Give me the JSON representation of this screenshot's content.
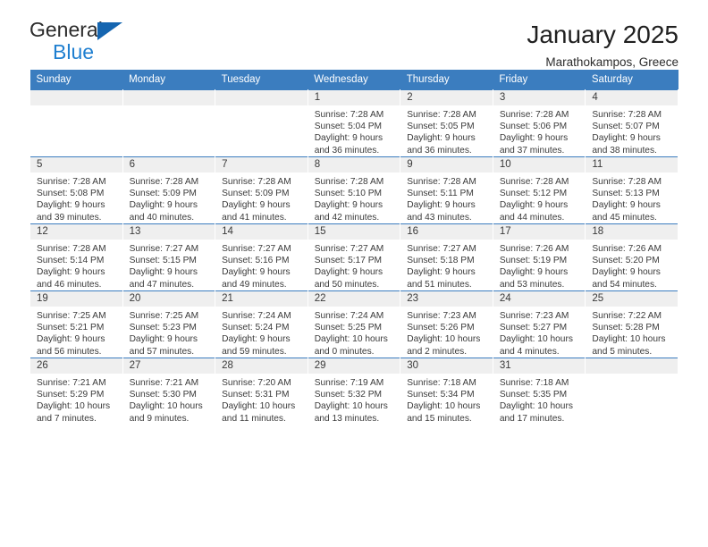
{
  "brand": {
    "line1": "General",
    "line2": "Blue",
    "triangle_color": "#1565b0",
    "blue_text_color": "#1f7fd0"
  },
  "header": {
    "title": "January 2025",
    "subtitle": "Marathokampos, Greece",
    "accent_color": "#3b7dbf",
    "daynum_band_color": "#efefef"
  },
  "weekday_headers": [
    "Sunday",
    "Monday",
    "Tuesday",
    "Wednesday",
    "Thursday",
    "Friday",
    "Saturday"
  ],
  "weeks": [
    [
      {
        "day": "",
        "sunrise": "",
        "sunset": "",
        "daylight_line1": "",
        "daylight_line2": ""
      },
      {
        "day": "",
        "sunrise": "",
        "sunset": "",
        "daylight_line1": "",
        "daylight_line2": ""
      },
      {
        "day": "",
        "sunrise": "",
        "sunset": "",
        "daylight_line1": "",
        "daylight_line2": ""
      },
      {
        "day": "1",
        "sunrise": "Sunrise: 7:28 AM",
        "sunset": "Sunset: 5:04 PM",
        "daylight_line1": "Daylight: 9 hours",
        "daylight_line2": "and 36 minutes."
      },
      {
        "day": "2",
        "sunrise": "Sunrise: 7:28 AM",
        "sunset": "Sunset: 5:05 PM",
        "daylight_line1": "Daylight: 9 hours",
        "daylight_line2": "and 36 minutes."
      },
      {
        "day": "3",
        "sunrise": "Sunrise: 7:28 AM",
        "sunset": "Sunset: 5:06 PM",
        "daylight_line1": "Daylight: 9 hours",
        "daylight_line2": "and 37 minutes."
      },
      {
        "day": "4",
        "sunrise": "Sunrise: 7:28 AM",
        "sunset": "Sunset: 5:07 PM",
        "daylight_line1": "Daylight: 9 hours",
        "daylight_line2": "and 38 minutes."
      }
    ],
    [
      {
        "day": "5",
        "sunrise": "Sunrise: 7:28 AM",
        "sunset": "Sunset: 5:08 PM",
        "daylight_line1": "Daylight: 9 hours",
        "daylight_line2": "and 39 minutes."
      },
      {
        "day": "6",
        "sunrise": "Sunrise: 7:28 AM",
        "sunset": "Sunset: 5:09 PM",
        "daylight_line1": "Daylight: 9 hours",
        "daylight_line2": "and 40 minutes."
      },
      {
        "day": "7",
        "sunrise": "Sunrise: 7:28 AM",
        "sunset": "Sunset: 5:09 PM",
        "daylight_line1": "Daylight: 9 hours",
        "daylight_line2": "and 41 minutes."
      },
      {
        "day": "8",
        "sunrise": "Sunrise: 7:28 AM",
        "sunset": "Sunset: 5:10 PM",
        "daylight_line1": "Daylight: 9 hours",
        "daylight_line2": "and 42 minutes."
      },
      {
        "day": "9",
        "sunrise": "Sunrise: 7:28 AM",
        "sunset": "Sunset: 5:11 PM",
        "daylight_line1": "Daylight: 9 hours",
        "daylight_line2": "and 43 minutes."
      },
      {
        "day": "10",
        "sunrise": "Sunrise: 7:28 AM",
        "sunset": "Sunset: 5:12 PM",
        "daylight_line1": "Daylight: 9 hours",
        "daylight_line2": "and 44 minutes."
      },
      {
        "day": "11",
        "sunrise": "Sunrise: 7:28 AM",
        "sunset": "Sunset: 5:13 PM",
        "daylight_line1": "Daylight: 9 hours",
        "daylight_line2": "and 45 minutes."
      }
    ],
    [
      {
        "day": "12",
        "sunrise": "Sunrise: 7:28 AM",
        "sunset": "Sunset: 5:14 PM",
        "daylight_line1": "Daylight: 9 hours",
        "daylight_line2": "and 46 minutes."
      },
      {
        "day": "13",
        "sunrise": "Sunrise: 7:27 AM",
        "sunset": "Sunset: 5:15 PM",
        "daylight_line1": "Daylight: 9 hours",
        "daylight_line2": "and 47 minutes."
      },
      {
        "day": "14",
        "sunrise": "Sunrise: 7:27 AM",
        "sunset": "Sunset: 5:16 PM",
        "daylight_line1": "Daylight: 9 hours",
        "daylight_line2": "and 49 minutes."
      },
      {
        "day": "15",
        "sunrise": "Sunrise: 7:27 AM",
        "sunset": "Sunset: 5:17 PM",
        "daylight_line1": "Daylight: 9 hours",
        "daylight_line2": "and 50 minutes."
      },
      {
        "day": "16",
        "sunrise": "Sunrise: 7:27 AM",
        "sunset": "Sunset: 5:18 PM",
        "daylight_line1": "Daylight: 9 hours",
        "daylight_line2": "and 51 minutes."
      },
      {
        "day": "17",
        "sunrise": "Sunrise: 7:26 AM",
        "sunset": "Sunset: 5:19 PM",
        "daylight_line1": "Daylight: 9 hours",
        "daylight_line2": "and 53 minutes."
      },
      {
        "day": "18",
        "sunrise": "Sunrise: 7:26 AM",
        "sunset": "Sunset: 5:20 PM",
        "daylight_line1": "Daylight: 9 hours",
        "daylight_line2": "and 54 minutes."
      }
    ],
    [
      {
        "day": "19",
        "sunrise": "Sunrise: 7:25 AM",
        "sunset": "Sunset: 5:21 PM",
        "daylight_line1": "Daylight: 9 hours",
        "daylight_line2": "and 56 minutes."
      },
      {
        "day": "20",
        "sunrise": "Sunrise: 7:25 AM",
        "sunset": "Sunset: 5:23 PM",
        "daylight_line1": "Daylight: 9 hours",
        "daylight_line2": "and 57 minutes."
      },
      {
        "day": "21",
        "sunrise": "Sunrise: 7:24 AM",
        "sunset": "Sunset: 5:24 PM",
        "daylight_line1": "Daylight: 9 hours",
        "daylight_line2": "and 59 minutes."
      },
      {
        "day": "22",
        "sunrise": "Sunrise: 7:24 AM",
        "sunset": "Sunset: 5:25 PM",
        "daylight_line1": "Daylight: 10 hours",
        "daylight_line2": "and 0 minutes."
      },
      {
        "day": "23",
        "sunrise": "Sunrise: 7:23 AM",
        "sunset": "Sunset: 5:26 PM",
        "daylight_line1": "Daylight: 10 hours",
        "daylight_line2": "and 2 minutes."
      },
      {
        "day": "24",
        "sunrise": "Sunrise: 7:23 AM",
        "sunset": "Sunset: 5:27 PM",
        "daylight_line1": "Daylight: 10 hours",
        "daylight_line2": "and 4 minutes."
      },
      {
        "day": "25",
        "sunrise": "Sunrise: 7:22 AM",
        "sunset": "Sunset: 5:28 PM",
        "daylight_line1": "Daylight: 10 hours",
        "daylight_line2": "and 5 minutes."
      }
    ],
    [
      {
        "day": "26",
        "sunrise": "Sunrise: 7:21 AM",
        "sunset": "Sunset: 5:29 PM",
        "daylight_line1": "Daylight: 10 hours",
        "daylight_line2": "and 7 minutes."
      },
      {
        "day": "27",
        "sunrise": "Sunrise: 7:21 AM",
        "sunset": "Sunset: 5:30 PM",
        "daylight_line1": "Daylight: 10 hours",
        "daylight_line2": "and 9 minutes."
      },
      {
        "day": "28",
        "sunrise": "Sunrise: 7:20 AM",
        "sunset": "Sunset: 5:31 PM",
        "daylight_line1": "Daylight: 10 hours",
        "daylight_line2": "and 11 minutes."
      },
      {
        "day": "29",
        "sunrise": "Sunrise: 7:19 AM",
        "sunset": "Sunset: 5:32 PM",
        "daylight_line1": "Daylight: 10 hours",
        "daylight_line2": "and 13 minutes."
      },
      {
        "day": "30",
        "sunrise": "Sunrise: 7:18 AM",
        "sunset": "Sunset: 5:34 PM",
        "daylight_line1": "Daylight: 10 hours",
        "daylight_line2": "and 15 minutes."
      },
      {
        "day": "31",
        "sunrise": "Sunrise: 7:18 AM",
        "sunset": "Sunset: 5:35 PM",
        "daylight_line1": "Daylight: 10 hours",
        "daylight_line2": "and 17 minutes."
      },
      {
        "day": "",
        "sunrise": "",
        "sunset": "",
        "daylight_line1": "",
        "daylight_line2": ""
      }
    ]
  ]
}
